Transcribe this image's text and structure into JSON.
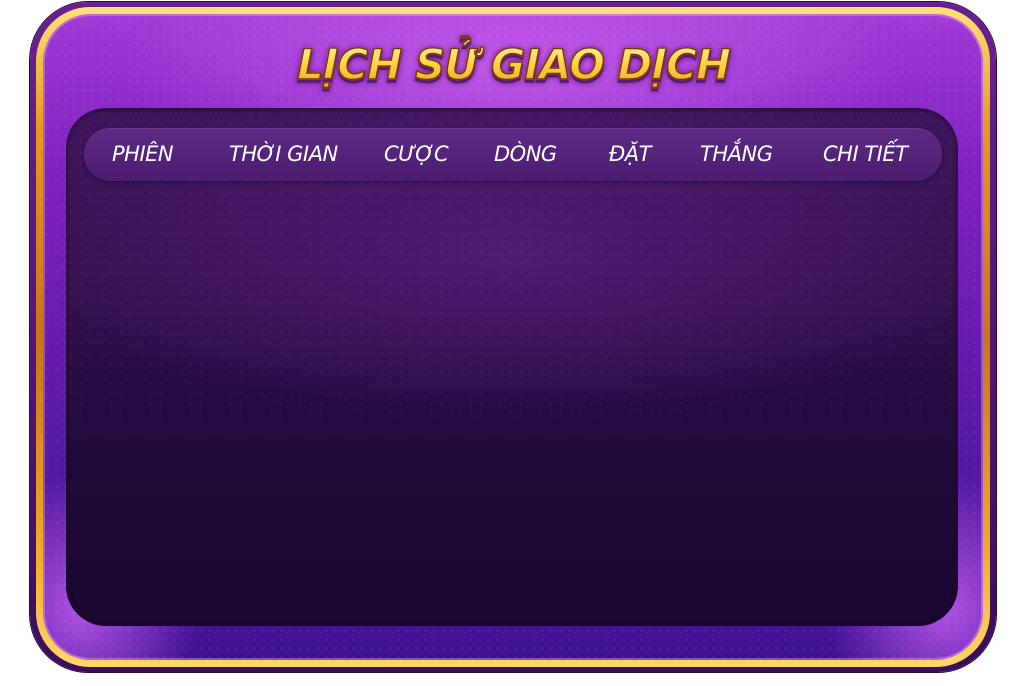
{
  "dialog": {
    "title": "LỊCH SỬ GIAO DỊCH",
    "columns": [
      {
        "label": "PHIÊN"
      },
      {
        "label": "THỜI GIAN"
      },
      {
        "label": "CƯỢC"
      },
      {
        "label": "DÒNG"
      },
      {
        "label": "ĐẶT"
      },
      {
        "label": "THẮNG"
      },
      {
        "label": "CHI TIẾT"
      }
    ],
    "rows": []
  },
  "colors": {
    "frame_gold": "#e59a1e",
    "frame_purple": "#7d20bf",
    "panel_dark": "#240a3e",
    "header_row": "#4b1d70",
    "title_gold": "#ffd54a"
  }
}
